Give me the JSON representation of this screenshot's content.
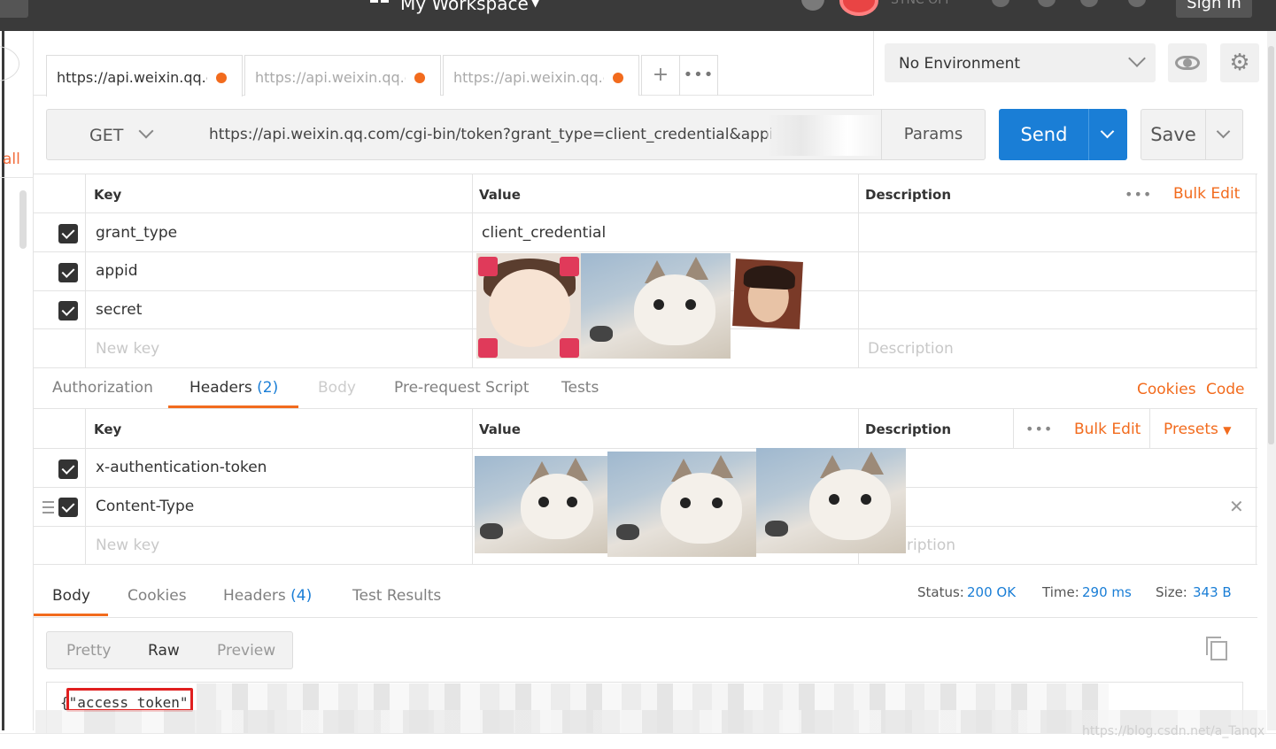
{
  "topbar": {
    "workspace": "My Workspace",
    "sync_label": "SYNC OFF",
    "signin_label": "Sign In"
  },
  "sidebar": {
    "all_label": "all"
  },
  "tabs": [
    {
      "label": "https://api.weixin.qq.c",
      "active": true,
      "unsaved": true
    },
    {
      "label": "https://api.weixin.qq.c",
      "active": false,
      "unsaved": true
    },
    {
      "label": "https://api.weixin.qq.c",
      "active": false,
      "unsaved": true
    }
  ],
  "tab_add_label": "+",
  "tab_more_label": "•••",
  "environment": {
    "selected": "No Environment"
  },
  "gear_glyph": "⚙",
  "request": {
    "method": "GET",
    "url": "https://api.weixin.qq.com/cgi-bin/token?grant_type=client_credential&appid=w",
    "params_label": "Params",
    "send_label": "Send",
    "save_label": "Save"
  },
  "params_table": {
    "headers": {
      "key": "Key",
      "value": "Value",
      "description": "Description"
    },
    "more": "•••",
    "bulk_edit": "Bulk Edit",
    "rows": [
      {
        "key": "grant_type",
        "value": "client_credential",
        "checked": true
      },
      {
        "key": "appid",
        "value": "",
        "checked": true
      },
      {
        "key": "secret",
        "value": "",
        "checked": true
      }
    ],
    "new_key_placeholder": "New key",
    "description_placeholder": "Description"
  },
  "section_tabs": {
    "authorization": "Authorization",
    "headers": "Headers",
    "headers_count": "(2)",
    "body": "Body",
    "prerequest": "Pre-request Script",
    "tests": "Tests",
    "cookies": "Cookies",
    "code": "Code"
  },
  "headers_table": {
    "headers": {
      "key": "Key",
      "value": "Value",
      "description": "Description"
    },
    "more": "•••",
    "bulk_edit": "Bulk Edit",
    "presets": "Presets",
    "rows": [
      {
        "key": "x-authentication-token",
        "checked": true
      },
      {
        "key": "Content-Type",
        "checked": true
      }
    ],
    "new_key_placeholder": "New key",
    "description_placeholder": "ription",
    "remove_glyph": "✕"
  },
  "response": {
    "tabs": {
      "body": "Body",
      "cookies": "Cookies",
      "headers": "Headers",
      "headers_count": "(4)",
      "test_results": "Test Results"
    },
    "status_label": "Status:",
    "status_value": "200 OK",
    "time_label": "Time:",
    "time_value": "290 ms",
    "size_label": "Size:",
    "size_value": "343 B",
    "modes": {
      "pretty": "Pretty",
      "raw": "Raw",
      "preview": "Preview"
    },
    "body_text": "{\"access_token\""
  },
  "watermark": "https://blog.csdn.net/a_Tanqx",
  "colors": {
    "accent": "#f26b1d",
    "send": "#1a7ed6",
    "highlight": "#e01f1f"
  }
}
